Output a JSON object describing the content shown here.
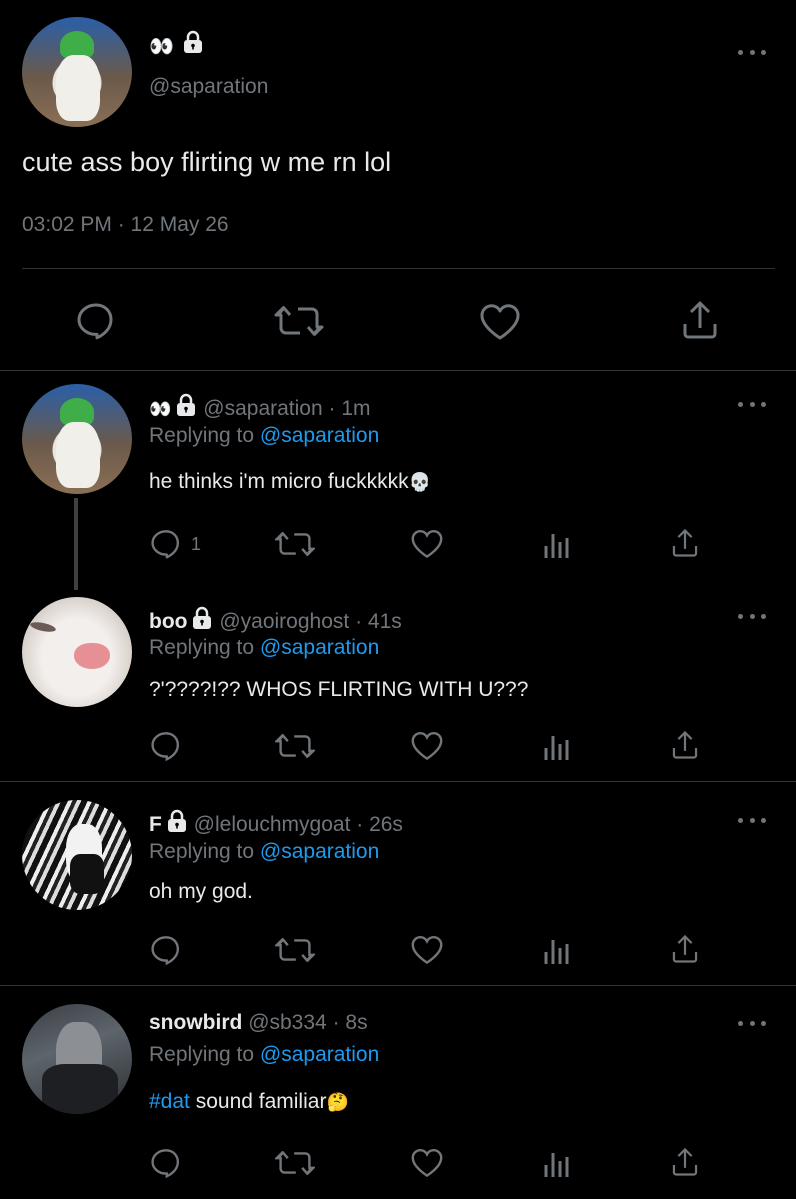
{
  "main_tweet": {
    "name_glyph": "👀",
    "handle": "@saparation",
    "text": "cute ass boy flirting w me rn lol",
    "timestamp": "03:02 PM · 12 May 26"
  },
  "replies": [
    {
      "name": "",
      "name_glyph": "👀",
      "handle": "@saparation",
      "time": "· 1m",
      "replying_prefix": "Replying to",
      "replying_to": "@saparation",
      "text": "he thinks i'm micro fuckkkkk",
      "text_emoji": "💀",
      "reply_count": "1"
    },
    {
      "name": "boo",
      "handle": "@yaoiroghost",
      "time": "· 41s",
      "replying_prefix": "Replying to",
      "replying_to": "@saparation",
      "text": "?'????!?? WHOS FLIRTING WITH U???"
    },
    {
      "name": "F",
      "handle": "@lelouchmygoat",
      "time": "· 26s",
      "replying_prefix": "Replying to",
      "replying_to": "@saparation",
      "text": "oh my god."
    },
    {
      "name": "snowbird",
      "handle": "@sb334",
      "time": "· 8s",
      "replying_prefix": "Replying to",
      "replying_to": "@saparation",
      "hashtag": "#dat",
      "text": " sound familiar",
      "text_emoji": "🤔"
    }
  ],
  "icons": {
    "reply": "reply-icon",
    "retweet": "retweet-icon",
    "like": "heart-icon",
    "views": "analytics-icon",
    "share": "share-icon",
    "more": "more-icon",
    "lock": "lock-icon"
  },
  "colors": {
    "background": "#000000",
    "text": "#e7e9ea",
    "muted": "#71767b",
    "link": "#1d9bf0",
    "divider": "#2f3336"
  }
}
